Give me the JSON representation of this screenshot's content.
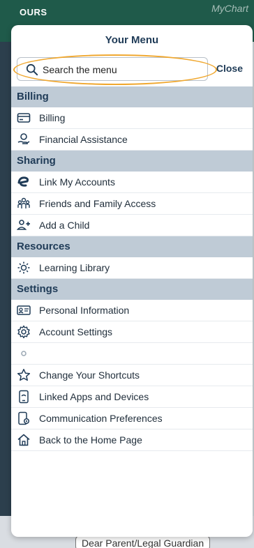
{
  "background": {
    "header_org": "OURS",
    "brand": "MyChart",
    "notice": "Dear Parent/Legal Guardian"
  },
  "menu": {
    "title": "Your Menu",
    "search_placeholder": "Search the menu",
    "close_label": "Close",
    "sections": [
      {
        "header": "Billing",
        "items": [
          {
            "label": "Billing",
            "icon": "credit-card-icon"
          },
          {
            "label": "Financial Assistance",
            "icon": "hand-coin-icon"
          }
        ]
      },
      {
        "header": "Sharing",
        "items": [
          {
            "label": "Link My Accounts",
            "icon": "link-e-icon"
          },
          {
            "label": "Friends and Family Access",
            "icon": "people-group-icon"
          },
          {
            "label": "Add a Child",
            "icon": "add-person-icon"
          }
        ]
      },
      {
        "header": "Resources",
        "items": [
          {
            "label": "Learning Library",
            "icon": "lightbulb-icon"
          }
        ]
      },
      {
        "header": "Settings",
        "items": [
          {
            "label": "Personal Information",
            "icon": "id-card-icon"
          },
          {
            "label": "Account Settings",
            "icon": "gear-icon"
          },
          {
            "label": "",
            "icon": "gear-icon"
          },
          {
            "label": "Change Your Shortcuts",
            "icon": "star-icon"
          },
          {
            "label": "Linked Apps and Devices",
            "icon": "phone-link-icon"
          },
          {
            "label": "Communication Preferences",
            "icon": "phone-settings-icon"
          },
          {
            "label": "Back to the Home Page",
            "icon": "home-icon"
          }
        ]
      }
    ]
  },
  "colors": {
    "accent": "#1f3b57",
    "section_bg": "#bfcbd6",
    "search_highlight": "#f0a830",
    "app_header": "#1f5a4a"
  }
}
